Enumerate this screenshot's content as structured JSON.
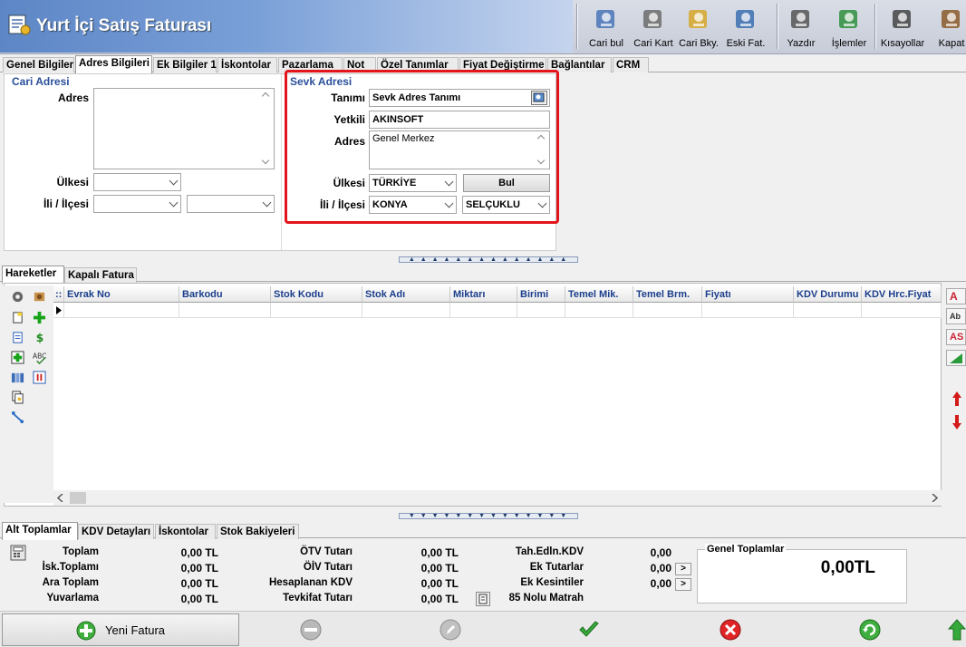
{
  "window": {
    "title": "Yurt İçi Satış Faturası"
  },
  "toolbar": {
    "items": [
      {
        "label": "Cari bul",
        "icon": "person-search-icon"
      },
      {
        "label": "Cari Kart",
        "icon": "person-card-icon"
      },
      {
        "label": "Cari Bky.",
        "icon": "person-balance-icon"
      },
      {
        "label": "Eski Fat.",
        "icon": "old-invoices-icon"
      },
      {
        "label": "Yazdır",
        "icon": "printer-icon"
      },
      {
        "label": "İşlemler",
        "icon": "operations-icon"
      },
      {
        "label": "Kısayollar",
        "icon": "keyboard-icon"
      },
      {
        "label": "Kapat",
        "icon": "close-book-icon"
      }
    ]
  },
  "tabs": [
    {
      "label": "Genel Bilgiler",
      "accel": "G",
      "active": false
    },
    {
      "label": "Adres Bilgileri",
      "accel": "r",
      "active": true
    },
    {
      "label": "Ek Bilgiler 1",
      "accel": "E",
      "active": false
    },
    {
      "label": "İskontolar",
      "accel": "İ",
      "active": false
    },
    {
      "label": "Pazarlama",
      "accel": "P",
      "active": false
    },
    {
      "label": "Not",
      "accel": "N",
      "active": false
    },
    {
      "label": "Özel Tanımlar",
      "accel": "Ö",
      "active": false
    },
    {
      "label": "Fiyat Değiştirme",
      "accel": "F",
      "active": false
    },
    {
      "label": "Bağlantılar",
      "accel": "B",
      "active": false
    },
    {
      "label": "CRM",
      "accel": "C",
      "active": false
    }
  ],
  "cari_adresi": {
    "title": "Cari Adresi",
    "adres_label": "Adres",
    "adres_value": "",
    "ulkesi_label": "Ülkesi",
    "ulkesi_value": "",
    "il_label": "İli / İlçesi",
    "il_value": "",
    "ilce_value": ""
  },
  "sevk_adresi": {
    "title": "Sevk Adresi",
    "tanimi_label": "Tanımı",
    "tanimi_value": "Sevk Adres Tanımı",
    "yetkili_label": "Yetkili",
    "yetkili_value": "AKINSOFT",
    "adres_label": "Adres",
    "adres_value": "Genel Merkez",
    "ulkesi_label": "Ülkesi",
    "ulkesi_value": "TÜRKİYE",
    "bul_label": "Bul",
    "il_label": "İli / İlçesi",
    "il_value": "KONYA",
    "ilce_value": "SELÇUKLU"
  },
  "hareket_tabs": [
    {
      "label": "Hareketler",
      "accel": "H",
      "active": true
    },
    {
      "label": "Kapalı Fatura",
      "accel": "K",
      "active": false
    }
  ],
  "grid": {
    "columns": [
      "Evrak No",
      "Barkodu",
      "Stok Kodu",
      "Stok Adı",
      "Miktarı",
      "Birimi",
      "Temel Mik.",
      "Temel Brm.",
      "Fiyatı",
      "KDV Durumu",
      "KDV Hrc.Fiyat"
    ],
    "rows": []
  },
  "right_tools": [
    "A",
    "Ab",
    "AS",
    ""
  ],
  "total_tabs": [
    {
      "label": "Alt Toplamlar",
      "accel": "A",
      "active": true
    },
    {
      "label": "KDV Detayları",
      "accel": "K",
      "active": false
    },
    {
      "label": "İskontolar",
      "accel": "İ",
      "active": false
    },
    {
      "label": "Stok Bakiyeleri",
      "accel": "S",
      "active": false
    }
  ],
  "totals": {
    "col1": [
      {
        "label": "Toplam",
        "value": "0,00 TL"
      },
      {
        "label": "İsk.Toplamı",
        "value": "0,00 TL"
      },
      {
        "label": "Ara Toplam",
        "value": "0,00 TL"
      },
      {
        "label": "Yuvarlama",
        "value": "0,00 TL"
      }
    ],
    "col2": [
      {
        "label": "ÖTV Tutarı",
        "value": "0,00 TL"
      },
      {
        "label": "ÖİV Tutarı",
        "value": "0,00 TL"
      },
      {
        "label": "Hesaplanan KDV",
        "value": "0,00 TL"
      },
      {
        "label": "Tevkifat Tutarı",
        "value": "0,00 TL"
      }
    ],
    "col3": [
      {
        "label": "Tah.Edln.KDV",
        "value": "0,00"
      },
      {
        "label": "Ek Tutarlar",
        "value": "0,00"
      },
      {
        "label": "Ek Kesintiler",
        "value": "0,00"
      },
      {
        "label": "85 Nolu Matrah",
        "value": ""
      }
    ],
    "genel_title": "Genel Toplamlar",
    "genel_value": "0,00TL"
  },
  "bottom": {
    "new_invoice_label": "Yeni Fatura"
  },
  "colors": {
    "title_bar_start": "#5d86c6",
    "group_title": "#2a4f9a",
    "highlight_frame": "#e2141c",
    "grid_header_text": "#1b3e8c"
  }
}
